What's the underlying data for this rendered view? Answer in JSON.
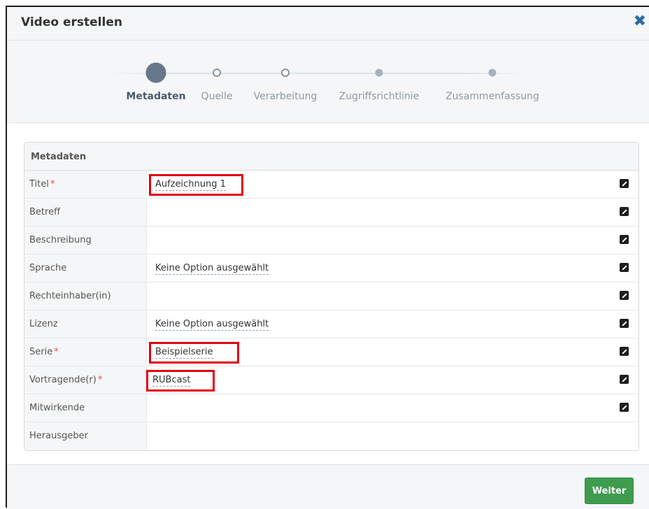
{
  "dialog": {
    "title": "Video erstellen",
    "close_icon": "close-icon"
  },
  "wizard": {
    "steps": [
      {
        "label": "Metadaten",
        "state": "active"
      },
      {
        "label": "Quelle",
        "state": "open"
      },
      {
        "label": "Verarbeitung",
        "state": "open"
      },
      {
        "label": "Zugriffsrichtlinie",
        "state": "disabled"
      },
      {
        "label": "Zusammenfassung",
        "state": "disabled"
      }
    ]
  },
  "metadata": {
    "heading": "Metadaten",
    "required_marker": "*",
    "rows": [
      {
        "label": "Titel",
        "required": true,
        "value": "Aufzeichnung 1",
        "editable": true
      },
      {
        "label": "Betreff",
        "required": false,
        "value": "",
        "editable": true
      },
      {
        "label": "Beschreibung",
        "required": false,
        "value": "",
        "editable": true
      },
      {
        "label": "Sprache",
        "required": false,
        "value": "Keine Option ausgewählt",
        "editable": true
      },
      {
        "label": "Rechteinhaber(in)",
        "required": false,
        "value": "",
        "editable": true
      },
      {
        "label": "Lizenz",
        "required": false,
        "value": "Keine Option ausgewählt",
        "editable": true
      },
      {
        "label": "Serie",
        "required": true,
        "value": "Beispielserie",
        "editable": true
      },
      {
        "label": "Vortragende(r)",
        "required": true,
        "value": "RUBcast",
        "editable": true
      },
      {
        "label": "Mitwirkende",
        "required": false,
        "value": "",
        "editable": true
      },
      {
        "label": "Herausgeber",
        "required": false,
        "value": "",
        "editable": false
      }
    ]
  },
  "footer": {
    "next_label": "Weiter"
  },
  "colors": {
    "accent_green": "#3e9c4e",
    "highlight_red": "#e3000f",
    "required_red": "#d9534f",
    "close_blue": "#2a6aa8"
  }
}
